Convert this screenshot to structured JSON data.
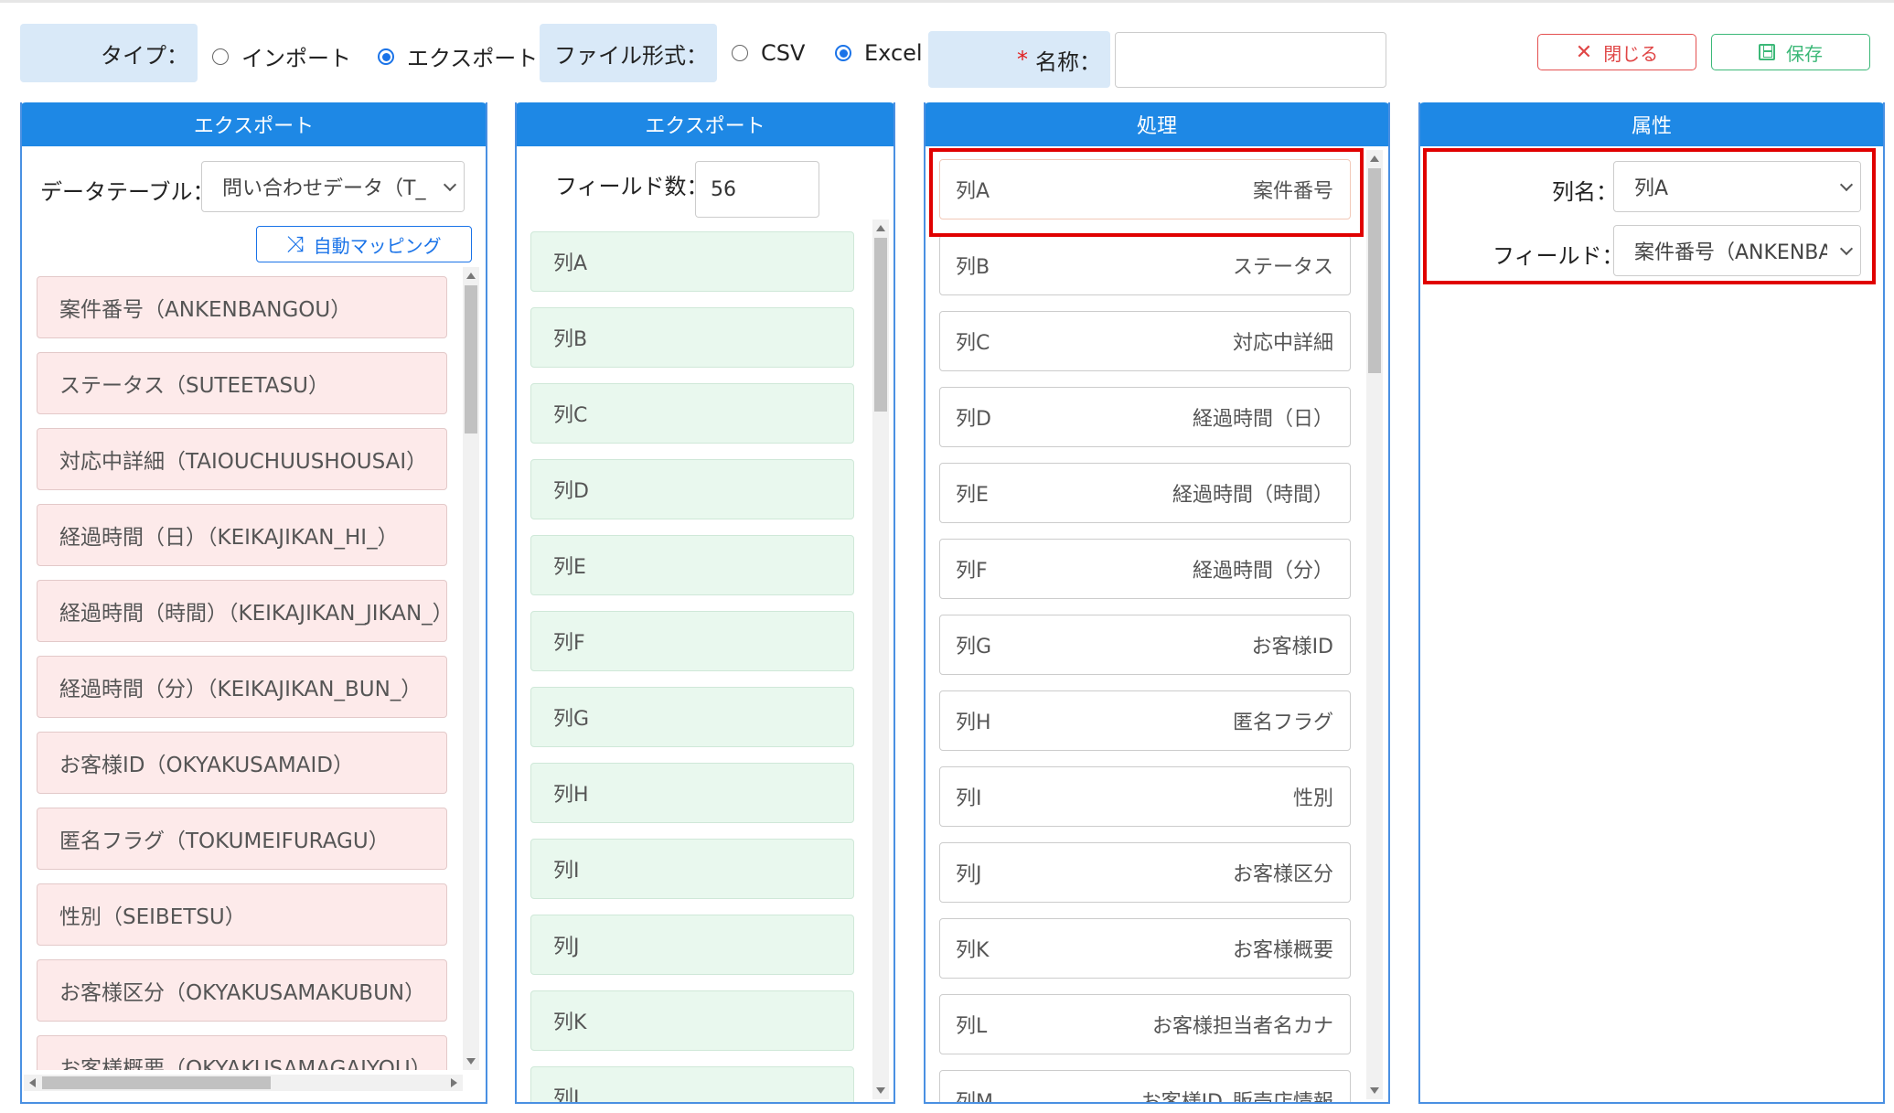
{
  "header": {
    "type_label": "タイプ：",
    "type_options": [
      {
        "label": "インポート",
        "selected": false
      },
      {
        "label": "エクスポート",
        "selected": true
      }
    ],
    "format_label": "ファイル形式：",
    "format_options": [
      {
        "label": "CSV",
        "selected": false
      },
      {
        "label": "Excel",
        "selected": true
      }
    ],
    "name_required_mark": "*",
    "name_label": "名称：",
    "name_value": "",
    "close_button": "閉じる",
    "save_button": "保存"
  },
  "panel_source": {
    "title": "エクスポート",
    "datatable_label": "データテーブル：",
    "datatable_value": "問い合わせデータ（T_",
    "auto_mapping_button": "自動マッピング",
    "fields": [
      "案件番号（ANKENBANGOU）",
      "ステータス（SUTEETASU）",
      "対応中詳細（TAIOUCHUUSHOUSAI）",
      "経過時間（日）（KEIKAJIKAN_HI_）",
      "経過時間（時間）（KEIKAJIKAN_JIKAN_）",
      "経過時間（分）（KEIKAJIKAN_BUN_）",
      "お客様ID（OKYAKUSAMAID）",
      "匿名フラグ（TOKUMEIFURAGU）",
      "性別（SEIBETSU）",
      "お客様区分（OKYAKUSAMAKUBUN）",
      "お客様概要（OKYAKUSAMAGAIYOU）"
    ]
  },
  "panel_columns": {
    "title": "エクスポート",
    "field_count_label": "フィールド数：",
    "field_count_value": "56",
    "columns": [
      "列A",
      "列B",
      "列C",
      "列D",
      "列E",
      "列F",
      "列G",
      "列H",
      "列I",
      "列J",
      "列K",
      "列L"
    ]
  },
  "panel_process": {
    "title": "処理",
    "mappings": [
      {
        "column": "列A",
        "field": "案件番号"
      },
      {
        "column": "列B",
        "field": "ステータス"
      },
      {
        "column": "列C",
        "field": "対応中詳細"
      },
      {
        "column": "列D",
        "field": "経過時間（日）"
      },
      {
        "column": "列E",
        "field": "経過時間（時間）"
      },
      {
        "column": "列F",
        "field": "経過時間（分）"
      },
      {
        "column": "列G",
        "field": "お客様ID"
      },
      {
        "column": "列H",
        "field": "匿名フラグ"
      },
      {
        "column": "列I",
        "field": "性別"
      },
      {
        "column": "列J",
        "field": "お客様区分"
      },
      {
        "column": "列K",
        "field": "お客様概要"
      },
      {
        "column": "列L",
        "field": "お客様担当者名カナ"
      },
      {
        "column": "列M",
        "field": "お客様ID_販売店情報"
      }
    ]
  },
  "panel_attributes": {
    "title": "属性",
    "column_name_label": "列名：",
    "column_name_value": "列A",
    "field_label": "フィールド：",
    "field_value": "案件番号（ANKENBA"
  },
  "colors": {
    "panel_header": "#1e88e5",
    "header_label_bg": "#d9e9f8",
    "source_card_bg": "#fdeaea",
    "column_card_bg": "#e9f8ee",
    "highlight": "#e00000",
    "close": "#e04646",
    "save": "#3cb878"
  }
}
